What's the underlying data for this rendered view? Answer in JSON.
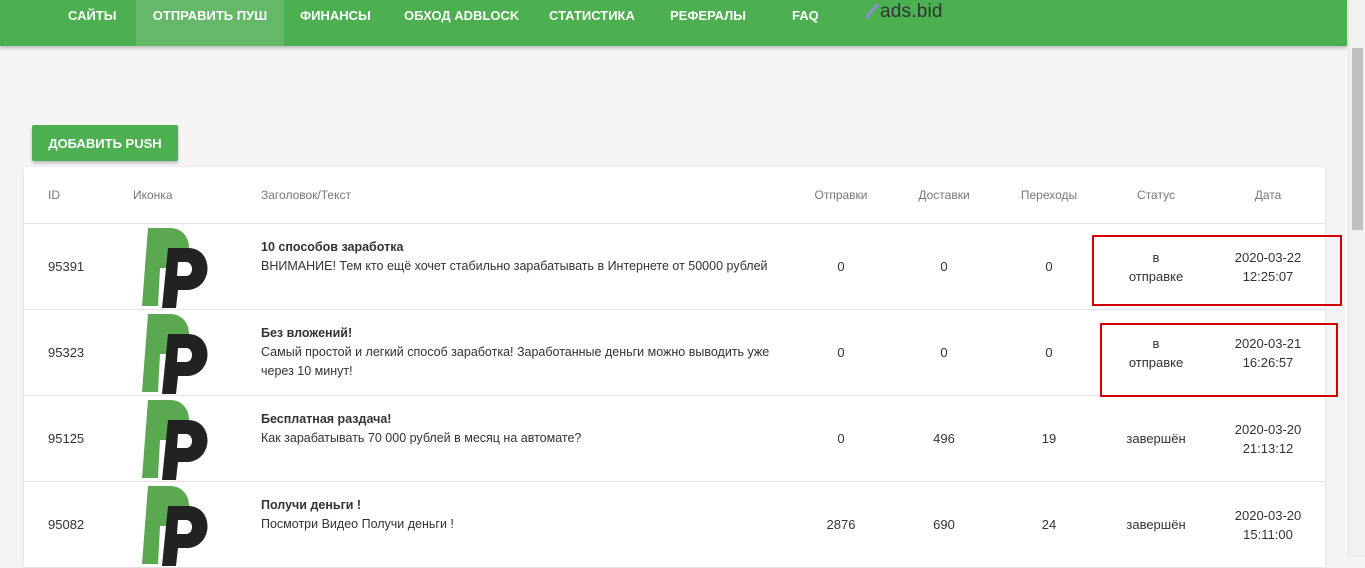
{
  "nav": {
    "items": [
      {
        "label": "САЙТЫ"
      },
      {
        "label": "ОТПРАВИТЬ ПУШ"
      },
      {
        "label": "ФИНАНСЫ"
      },
      {
        "label": "ОБХОД ADBLOCK"
      },
      {
        "label": "СТАТИСТИКА"
      },
      {
        "label": "РЕФЕРАЛЫ"
      },
      {
        "label": "FAQ"
      }
    ],
    "logo_text": "ads.bid"
  },
  "add_button_label": "ДОБАВИТЬ PUSH",
  "table": {
    "headers": [
      "ID",
      "Иконка",
      "Заголовок/Текст",
      "Отправки",
      "Доставки",
      "Переходы",
      "Статус",
      "Дата"
    ],
    "rows": [
      {
        "id": "95391",
        "title": "10 способов заработка",
        "text": "ВНИМАНИЕ! Тем кто ещё хочет стабильно зарабатывать в Интернете от 50000 рублей",
        "sends": "0",
        "deliveries": "0",
        "clicks": "0",
        "status_line1": "в",
        "status_line2": "отправке",
        "date": "2020-03-22",
        "time": "12:25:07"
      },
      {
        "id": "95323",
        "title": "Без вложений!",
        "text": "Самый простой и легкий способ заработка! Заработанные деньги можно выводить уже через 10 минут!",
        "sends": "0",
        "deliveries": "0",
        "clicks": "0",
        "status_line1": "в",
        "status_line2": "отправке",
        "date": "2020-03-21",
        "time": "16:26:57"
      },
      {
        "id": "95125",
        "title": "Бесплатная раздача!",
        "text": "Как зарабатывать 70 000 рублей в месяц на автомате?",
        "sends": "0",
        "deliveries": "496",
        "clicks": "19",
        "status_line1": "завершён",
        "status_line2": "",
        "date": "2020-03-20",
        "time": "21:13:12"
      },
      {
        "id": "95082",
        "title": "Получи деньги !",
        "text": "Посмотри Видео Получи деньги !",
        "sends": "2876",
        "deliveries": "690",
        "clicks": "24",
        "status_line1": "завершён",
        "status_line2": "",
        "date": "2020-03-20",
        "time": "15:11:00"
      }
    ]
  },
  "colors": {
    "nav_bg": "#4caf50",
    "highlight": "#d40000",
    "icon_green": "#5aa84f",
    "icon_dark": "#222222"
  }
}
